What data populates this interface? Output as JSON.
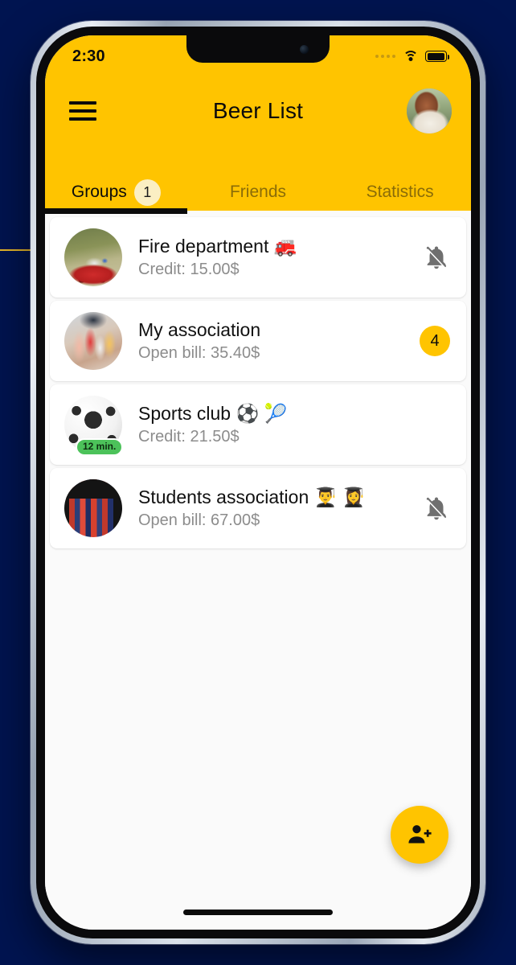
{
  "statusbar": {
    "time": "2:30",
    "signal_icon": "signal-dots-icon",
    "wifi_icon": "wifi-icon",
    "battery_icon": "battery-full-icon"
  },
  "toolbar": {
    "menu_icon": "hamburger-menu-icon",
    "title": "Beer List",
    "avatar_icon": "user-avatar"
  },
  "tabs": [
    {
      "label": "Groups",
      "badge": "1",
      "active": true
    },
    {
      "label": "Friends",
      "badge": "",
      "active": false
    },
    {
      "label": "Statistics",
      "badge": "",
      "active": false
    }
  ],
  "groups": [
    {
      "title": "Fire department 🚒",
      "subtitle": "Credit: 15.00$",
      "thumb": "fire-truck-photo",
      "trailing": "bell-off-icon",
      "badge": "",
      "chip": ""
    },
    {
      "title": "My association",
      "subtitle": "Open bill: 35.40$",
      "thumb": "cheers-drinks-photo",
      "trailing": "count-badge",
      "badge": "4",
      "chip": ""
    },
    {
      "title": "Sports club ⚽ 🎾",
      "subtitle": "Credit: 21.50$",
      "thumb": "soccer-ball-photo",
      "trailing": "",
      "badge": "",
      "chip": "12 min."
    },
    {
      "title": "Students association 👨‍🎓 👩‍🎓",
      "subtitle": "Open bill: 67.00$",
      "thumb": "books-photo",
      "trailing": "bell-off-icon",
      "badge": "",
      "chip": ""
    }
  ],
  "fab": {
    "icon": "person-add-icon"
  },
  "colors": {
    "accent": "#FFC400",
    "badge_pale": "#FBEFC3",
    "chip_green": "#4CC25A",
    "page_background": "#001450",
    "list_background": "#FAFAFA"
  }
}
